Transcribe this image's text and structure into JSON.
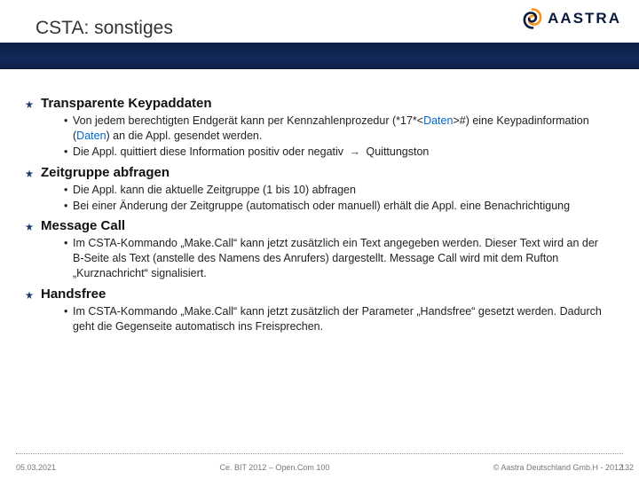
{
  "header": {
    "title": "CSTA: sonstiges",
    "logo_text": "AASTRA"
  },
  "sections": [
    {
      "title": "Transparente Keypaddaten",
      "bullets": [
        {
          "parts": [
            {
              "t": "Von jedem berechtigten Endgerät kann per Kennzahlenprozedur (*17*<"
            },
            {
              "t": "Daten",
              "cls": "link"
            },
            {
              "t": ">#) eine Keypadinformation ("
            },
            {
              "t": "Daten",
              "cls": "link"
            },
            {
              "t": ") an die Appl. gesendet werden."
            }
          ]
        },
        {
          "parts": [
            {
              "t": "Die Appl. quittiert diese Information positiv oder negativ "
            },
            {
              "t": "→",
              "cls": "arrow"
            },
            {
              "t": " Quittungston"
            }
          ]
        }
      ]
    },
    {
      "title": "Zeitgruppe abfragen",
      "bullets": [
        {
          "parts": [
            {
              "t": "Die Appl. kann die aktuelle Zeitgruppe (1 bis 10) abfragen"
            }
          ]
        },
        {
          "parts": [
            {
              "t": "Bei einer Änderung der Zeitgruppe (automatisch oder manuell) erhält die Appl. eine Benachrichtigung"
            }
          ]
        }
      ]
    },
    {
      "title": "Message Call",
      "bullets": [
        {
          "parts": [
            {
              "t": "Im CSTA-Kommando „Make.Call“ kann jetzt zusätzlich ein Text angegeben werden. Dieser Text wird an der B-Seite als Text (anstelle des Namens des Anrufers) dargestellt. Message Call wird mit dem Rufton „Kurznachricht“ signalisiert."
            }
          ]
        }
      ]
    },
    {
      "title": "Handsfree",
      "bullets": [
        {
          "parts": [
            {
              "t": "Im CSTA-Kommando „Make.Call“ kann jetzt zusätzlich der Parameter „Handsfree“ gesetzt werden. Dadurch geht die Gegenseite automatisch ins Freisprechen."
            }
          ]
        }
      ]
    }
  ],
  "footer": {
    "date": "05.03.2021",
    "center": "Ce. BIT 2012 – Open.Com 100",
    "right": "© Aastra Deutschland Gmb.H - 2012",
    "page": "132"
  }
}
